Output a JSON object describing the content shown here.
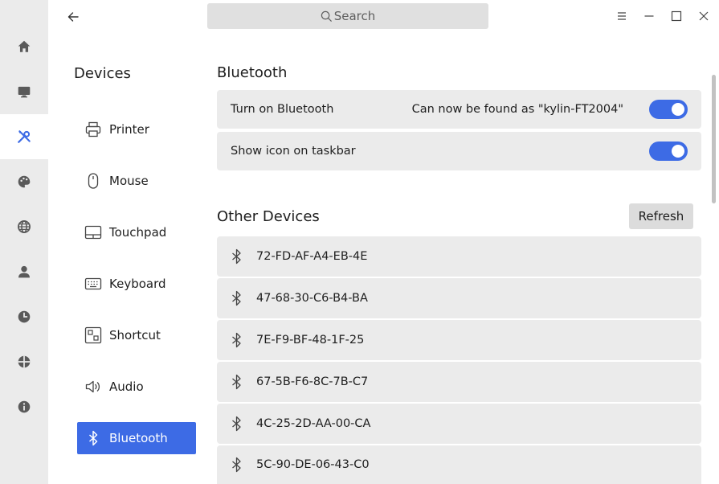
{
  "rail": {
    "items": [
      {
        "icon": "home-icon"
      },
      {
        "icon": "monitor-icon"
      },
      {
        "icon": "tools-icon",
        "active": true
      },
      {
        "icon": "palette-icon"
      },
      {
        "icon": "globe-icon"
      },
      {
        "icon": "user-icon"
      },
      {
        "icon": "clock-icon"
      },
      {
        "icon": "security-icon"
      },
      {
        "icon": "info-icon"
      }
    ]
  },
  "titlebar": {
    "search_placeholder": "Search"
  },
  "nav": {
    "title": "Devices",
    "items": [
      {
        "label": "Printer",
        "icon": "printer-icon"
      },
      {
        "label": "Mouse",
        "icon": "mouse-icon"
      },
      {
        "label": "Touchpad",
        "icon": "touchpad-icon"
      },
      {
        "label": "Keyboard",
        "icon": "keyboard-icon"
      },
      {
        "label": "Shortcut",
        "icon": "shortcut-icon"
      },
      {
        "label": "Audio",
        "icon": "audio-icon"
      },
      {
        "label": "Bluetooth",
        "icon": "bluetooth-icon",
        "active": true
      }
    ]
  },
  "main": {
    "bluetooth_title": "Bluetooth",
    "turn_on_label": "Turn on Bluetooth",
    "found_as_text": "Can now be found as \"kylin-FT2004\"",
    "turn_on_enabled": true,
    "show_icon_label": "Show icon on taskbar",
    "show_icon_enabled": true,
    "other_devices_title": "Other Devices",
    "refresh_label": "Refresh",
    "devices": [
      "72-FD-AF-A4-EB-4E",
      "47-68-30-C6-B4-BA",
      "7E-F9-BF-48-1F-25",
      "67-5B-F6-8C-7B-C7",
      "4C-25-2D-AA-00-CA",
      "5C-90-DE-06-43-C0"
    ]
  },
  "colors": {
    "accent": "#3d6be5",
    "card_bg": "#ebebeb",
    "rail_bg": "#ebebeb"
  }
}
